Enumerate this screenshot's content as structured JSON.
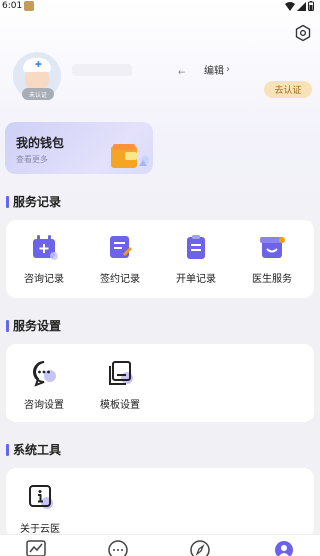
{
  "status_bar": {
    "time": "6:01"
  },
  "profile": {
    "cert_badge": "未认证",
    "edit_label": "编辑",
    "verify_label": "去认证"
  },
  "wallet": {
    "title": "我的钱包",
    "subtitle": "查看更多"
  },
  "sections": {
    "service_records": {
      "title": "服务记录",
      "items": [
        {
          "label": "咨询记录",
          "icon": "calendar-plus-icon"
        },
        {
          "label": "签约记录",
          "icon": "contract-edit-icon"
        },
        {
          "label": "开单记录",
          "icon": "clipboard-icon"
        },
        {
          "label": "医生服务",
          "icon": "doctor-service-icon"
        }
      ]
    },
    "service_settings": {
      "title": "服务设置",
      "items": [
        {
          "label": "咨询设置",
          "icon": "chat-bubble-icon"
        },
        {
          "label": "模板设置",
          "icon": "template-icon"
        }
      ]
    },
    "system_tools": {
      "title": "系统工具",
      "items": [
        {
          "label": "关于云医",
          "icon": "info-icon"
        }
      ]
    }
  },
  "colors": {
    "accent": "#6366f1",
    "verify_bg": "#f8e3b8",
    "page_bg": "#f1f1f5"
  }
}
